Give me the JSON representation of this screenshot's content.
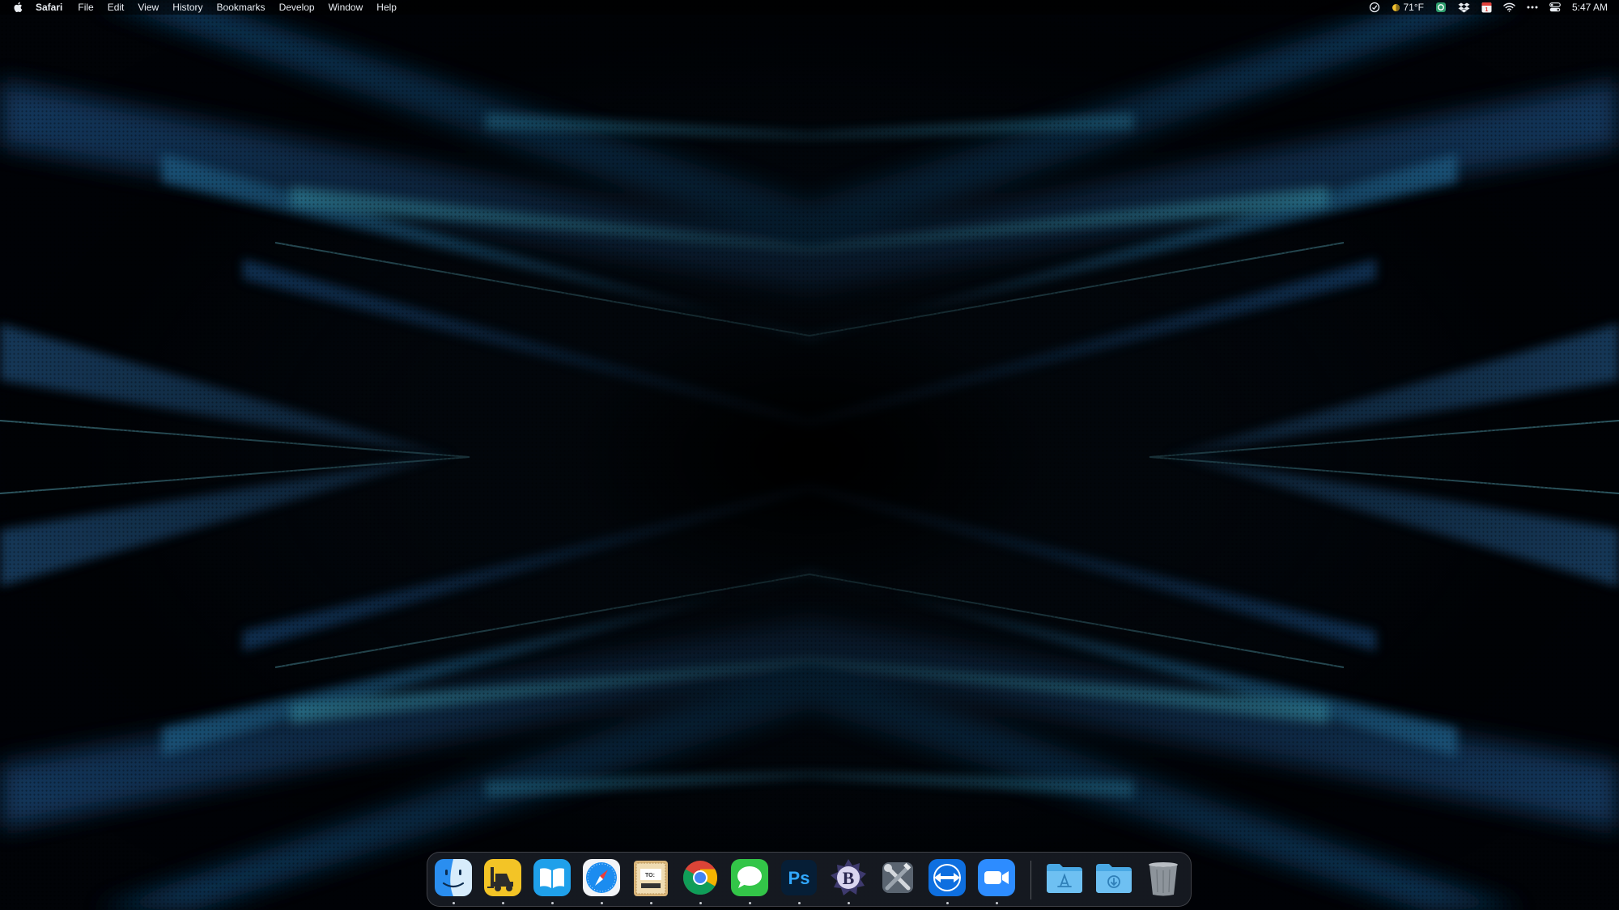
{
  "menubar": {
    "apple_icon": "apple-logo-icon",
    "app_name": "Safari",
    "menus": [
      "File",
      "Edit",
      "View",
      "History",
      "Bookmarks",
      "Develop",
      "Window",
      "Help"
    ],
    "status": {
      "weather_temp": "71°F",
      "clock": "5:47 AM",
      "icons": [
        "focus-icon",
        "weather-icon",
        "vpn-icon",
        "dropbox-icon",
        "calendar-icon",
        "wifi-icon",
        "more-icon",
        "control-center-icon"
      ]
    }
  },
  "dock": {
    "apps": [
      {
        "name": "Finder",
        "icon": "finder-icon",
        "running": true
      },
      {
        "name": "Transmit",
        "icon": "forklift-icon",
        "running": true
      },
      {
        "name": "Books",
        "icon": "books-icon",
        "running": true
      },
      {
        "name": "Safari",
        "icon": "safari-icon",
        "running": true
      },
      {
        "name": "Postage",
        "icon": "postage-icon",
        "running": true
      },
      {
        "name": "Google Chrome",
        "icon": "chrome-icon",
        "running": true
      },
      {
        "name": "Messages",
        "icon": "messages-icon",
        "running": true
      },
      {
        "name": "Photoshop",
        "icon": "photoshop-icon",
        "running": true
      },
      {
        "name": "BBEdit",
        "icon": "bbedit-icon",
        "running": true
      },
      {
        "name": "Xcode Tools",
        "icon": "tools-icon",
        "running": false
      },
      {
        "name": "TeamViewer",
        "icon": "teamviewer-icon",
        "running": true
      },
      {
        "name": "Zoom",
        "icon": "zoom-icon",
        "running": true
      }
    ],
    "stacks": [
      {
        "name": "Applications",
        "icon": "applications-folder-icon"
      },
      {
        "name": "Downloads",
        "icon": "downloads-folder-icon"
      },
      {
        "name": "Trash",
        "icon": "trash-icon"
      }
    ],
    "ps_label": "Ps",
    "bbedit_label": "B",
    "postage_label": "TO:"
  },
  "colors": {
    "wallpaper_accent": "#2a7fb0",
    "wallpaper_base": "#02060c"
  }
}
